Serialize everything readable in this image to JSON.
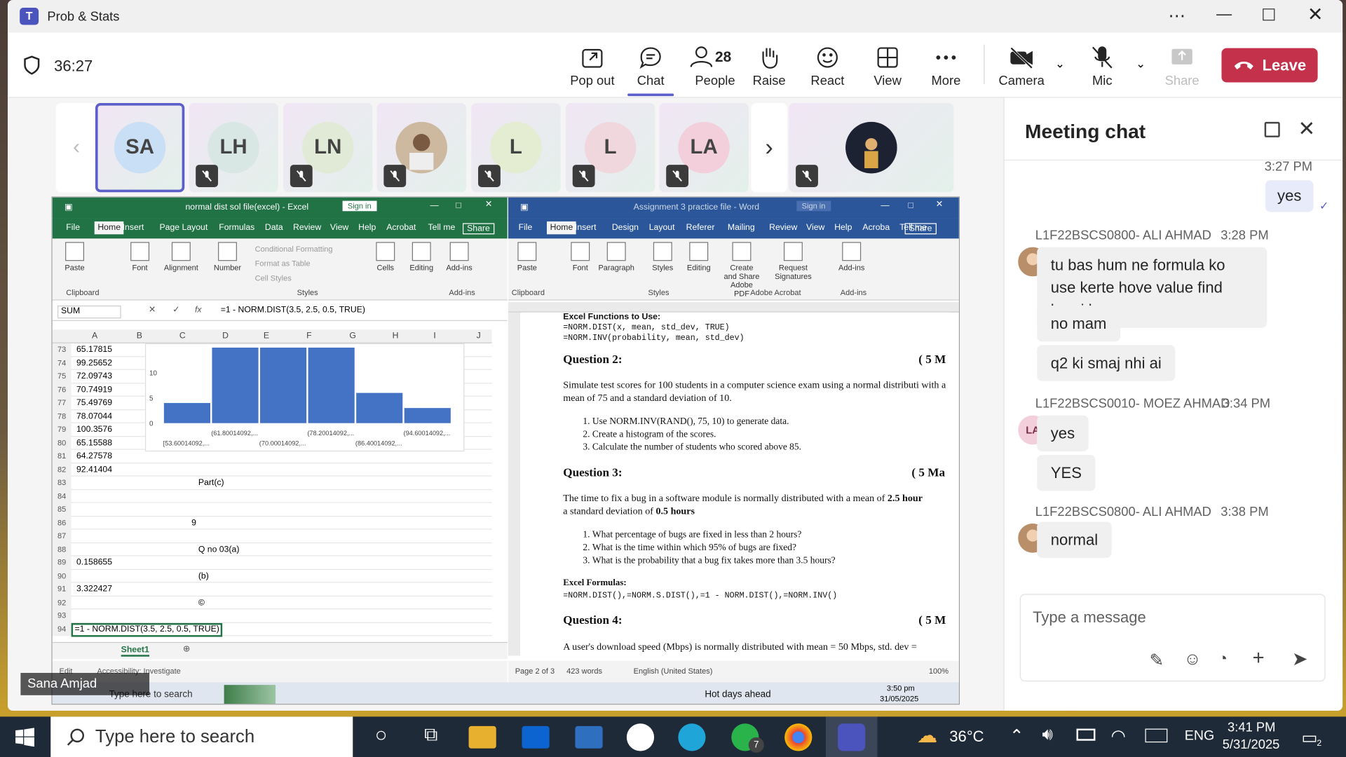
{
  "window": {
    "title": "Prob & Stats",
    "timer": "36:27"
  },
  "toolbar": [
    {
      "label": "Pop out",
      "icon": "pop-out-icon"
    },
    {
      "label": "Chat",
      "icon": "chat-icon"
    },
    {
      "label": "People",
      "icon": "people-icon",
      "count": "28"
    },
    {
      "label": "Raise",
      "icon": "raise-hand-icon"
    },
    {
      "label": "React",
      "icon": "react-icon"
    },
    {
      "label": "View",
      "icon": "view-icon"
    },
    {
      "label": "More",
      "icon": "more-icon"
    },
    {
      "label": "Camera",
      "icon": "camera-off-icon"
    },
    {
      "label": "Mic",
      "icon": "mic-off-icon"
    },
    {
      "label": "Share",
      "icon": "share-icon"
    }
  ],
  "leave_label": "Leave",
  "participants": [
    {
      "initials": "SA",
      "color": "#c9dff5"
    },
    {
      "initials": "LH",
      "color": "#d9e7e4"
    },
    {
      "initials": "LN",
      "color": "#e1ead6"
    },
    {
      "initials": "",
      "color": "#d6c9b9"
    },
    {
      "initials": "L",
      "color": "#e4ecd2"
    },
    {
      "initials": "L",
      "color": "#f0d7de"
    },
    {
      "initials": "LA",
      "color": "#f3cfdc"
    }
  ],
  "presenter_name": "Sana Amjad",
  "excel": {
    "title": "normal dist sol file(excel) - Excel",
    "signin": "Sign in",
    "share": "Share",
    "tabs": [
      "File",
      "Home",
      "Insert",
      "Page Layout",
      "Formulas",
      "Data",
      "Review",
      "View",
      "Help",
      "Acrobat",
      "Tell me"
    ],
    "ribbon_groups": [
      "Paste",
      "Font",
      "Alignment",
      "Number",
      "Cells",
      "Editing",
      "Add-ins"
    ],
    "ribbon_styles": [
      "Conditional Formatting",
      "Format as Table",
      "Cell Styles"
    ],
    "group_labels": [
      "Clipboard",
      "Styles",
      "Add-ins"
    ],
    "name_box": "SUM",
    "formula": "=1 - NORM.DIST(3.5, 2.5, 0.5, TRUE)",
    "columns": [
      "A",
      "B",
      "C",
      "D",
      "E",
      "F",
      "G",
      "H",
      "I",
      "J"
    ],
    "rows": [
      {
        "n": "73",
        "a": "65.17815",
        "c": ""
      },
      {
        "n": "74",
        "a": "99.25652",
        "c": ""
      },
      {
        "n": "75",
        "a": "72.09743",
        "c": ""
      },
      {
        "n": "76",
        "a": "70.74919",
        "c": ""
      },
      {
        "n": "77",
        "a": "75.49769",
        "c": ""
      },
      {
        "n": "78",
        "a": "78.07044",
        "c": ""
      },
      {
        "n": "79",
        "a": "100.3576",
        "c": ""
      },
      {
        "n": "80",
        "a": "65.15588",
        "c": ""
      },
      {
        "n": "81",
        "a": "64.27578",
        "c": ""
      },
      {
        "n": "82",
        "a": "92.41404",
        "c": ""
      },
      {
        "n": "83",
        "a": "",
        "c": "Part(c)"
      },
      {
        "n": "84",
        "a": "",
        "c": ""
      },
      {
        "n": "85",
        "a": "",
        "c": ""
      },
      {
        "n": "86",
        "a": "",
        "c": "9"
      },
      {
        "n": "87",
        "a": "",
        "c": ""
      },
      {
        "n": "88",
        "a": "",
        "c": "Q no 03(a)"
      },
      {
        "n": "89",
        "a": "0.158655",
        "c": ""
      },
      {
        "n": "90",
        "a": "",
        "c": "(b)"
      },
      {
        "n": "91",
        "a": "3.322427",
        "c": ""
      },
      {
        "n": "92",
        "a": "",
        "c": "©"
      },
      {
        "n": "93",
        "a": "",
        "c": ""
      },
      {
        "n": "94",
        "a": "=1 - NORM.DIST(3.5, 2.5, 0.5, TRUE)",
        "c": ""
      }
    ],
    "chart_yticks": [
      "10",
      "5",
      "0"
    ],
    "chart_bars": [
      4,
      20,
      20,
      20,
      6,
      3
    ],
    "chart_xlabels_top": [
      "(61.80014092,...",
      "(78.20014092,...",
      "(94.60014092,..."
    ],
    "chart_xlabels_bottom": [
      "[53.60014092,...",
      "(70.00014092,...",
      "(86.40014092,..."
    ],
    "sheet_tab": "Sheet1",
    "status": "Edit",
    "accessibility": "Accessibility: Investigate"
  },
  "word": {
    "title": "Assignment 3 practice file - Word",
    "signin": "Sign in",
    "share": "Share",
    "tabs": [
      "File",
      "Home",
      "Insert",
      "Design",
      "Layout",
      "Referer",
      "Mailing",
      "Review",
      "View",
      "Help",
      "Acroba",
      "Tell me"
    ],
    "ribbon_groups": [
      "Paste",
      "Font",
      "Paragraph",
      "Styles",
      "Editing",
      "Create and Share Adobe PDF",
      "Request Signatures",
      "Add-ins"
    ],
    "group_labels": [
      "Clipboard",
      "Styles",
      "Adobe Acrobat",
      "Add-ins"
    ],
    "doc": {
      "h0": "Excel Functions to Use:",
      "f1": "=NORM.DIST(x, mean, std_dev, TRUE)",
      "f2": "=NORM.INV(probability, mean, std_dev)",
      "q2": "Question 2:",
      "q2m": "( 5 M",
      "q2t": "Simulate test scores for 100 students in a computer science exam using a normal distributi with a mean of 75 and a standard deviation of 10.",
      "q2l": [
        "Use NORM.INV(RAND(), 75, 10) to generate data.",
        "Create a histogram of the scores.",
        "Calculate the number of students who scored above 85."
      ],
      "q3": "Question 3:",
      "q3m": "( 5 Ma",
      "q3t1": "The time to fix a bug in a software module is normally distributed with a mean of ",
      "q3b1": "2.5 hour",
      "q3t2": "a standard deviation of ",
      "q3b2": "0.5 hours",
      "q3l": [
        "What percentage of bugs are fixed in less than 2 hours?",
        "What is the time within which 95% of bugs are fixed?",
        "What is the probability that a bug fix takes more than 3.5 hours?"
      ],
      "ef": "Excel Formulas:",
      "ef1": "=NORM.DIST(),=NORM.S.DIST(),=1 - NORM.DIST(),=NORM.INV()",
      "q4": "Question 4:",
      "q4m": "( 5 M",
      "q4t": "A user's download speed (Mbps) is normally distributed with mean = 50 Mbps, std. dev ="
    },
    "status_page": "Page 2 of 3",
    "status_words": "423 words",
    "status_lang": "English (United States)",
    "zoom": "100%"
  },
  "inner_taskbar": {
    "search": "Type here to search",
    "weather": "Hot days ahead",
    "time": "3:50 pm",
    "date": "31/05/2025"
  },
  "chat": {
    "title": "Meeting chat",
    "first_time": "3:27 PM",
    "my_msg": "yes",
    "groups": [
      {
        "sender": "L1F22BSCS0800- ALI AHMAD",
        "time": "3:28 PM",
        "msgs": [
          "tu bas hum ne formula ko use kerte hove value find kerni he",
          "no mam",
          "q2 ki smaj nhi ai"
        ]
      },
      {
        "sender": "L1F22BSCS0010- MOEZ AHMAD",
        "time": "3:34 PM",
        "msgs": [
          "yes",
          "YES"
        ],
        "initials": "LA"
      },
      {
        "sender": "L1F22BSCS0800- ALI AHMAD",
        "time": "3:38 PM",
        "msgs": [
          "normal"
        ]
      }
    ],
    "input_placeholder": "Type a message"
  },
  "taskbar": {
    "search": "Type here to search",
    "temp": "36°C",
    "lang": "ENG",
    "time": "3:41 PM",
    "date": "5/31/2025",
    "badge": "7",
    "notif": "2"
  }
}
